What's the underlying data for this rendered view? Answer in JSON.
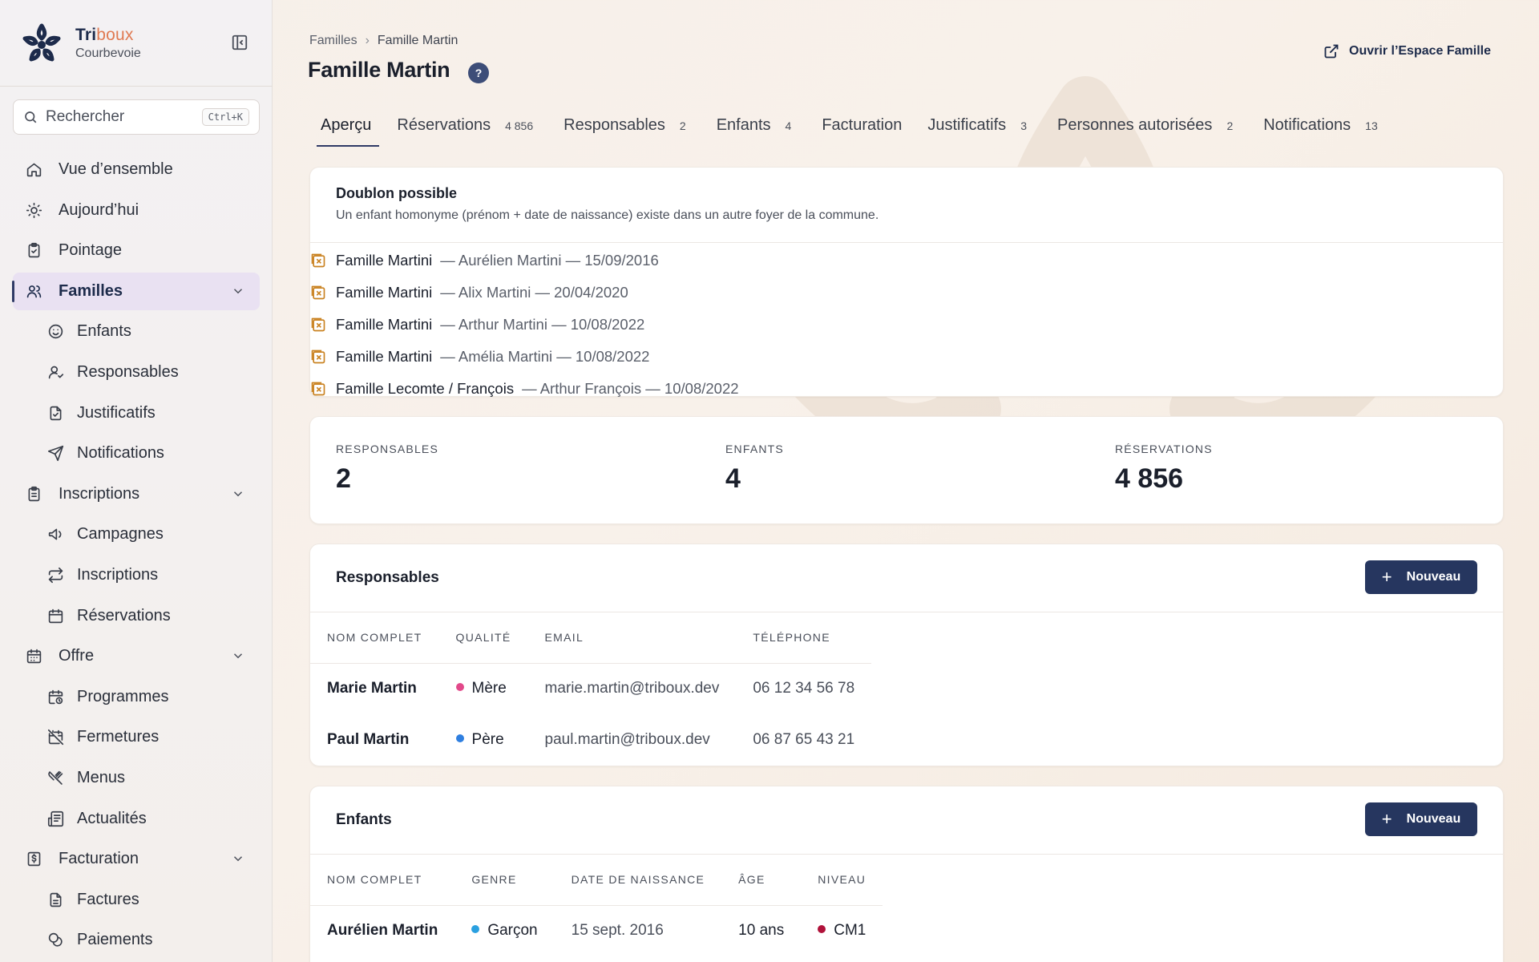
{
  "brand": {
    "name_part1": "Tri",
    "name_part2": "boux",
    "city": "Courbevoie"
  },
  "search": {
    "placeholder": "Rechercher",
    "shortcut": "Ctrl+K"
  },
  "sidebar": {
    "items": [
      {
        "label": "Vue d’ensemble",
        "icon": "home-icon"
      },
      {
        "label": "Aujourd’hui",
        "icon": "sun-icon"
      },
      {
        "label": "Pointage",
        "icon": "clipboard-check-icon"
      },
      {
        "label": "Familles",
        "icon": "users-icon",
        "active": true,
        "expanded": true
      },
      {
        "label": "Enfants",
        "icon": "smile-icon",
        "sub": true
      },
      {
        "label": "Responsables",
        "icon": "user-check-icon",
        "sub": true
      },
      {
        "label": "Justificatifs",
        "icon": "file-check-icon",
        "sub": true
      },
      {
        "label": "Notifications",
        "icon": "send-icon",
        "sub": true
      },
      {
        "label": "Inscriptions",
        "icon": "clipboard-list-icon",
        "expandable": true
      },
      {
        "label": "Campagnes",
        "icon": "megaphone-icon",
        "sub": true
      },
      {
        "label": "Inscriptions",
        "icon": "repeat-icon",
        "sub": true
      },
      {
        "label": "Réservations",
        "icon": "calendar-icon",
        "sub": true
      },
      {
        "label": "Offre",
        "icon": "calendar-days-icon",
        "expandable": true
      },
      {
        "label": "Programmes",
        "icon": "calendar-clock-icon",
        "sub": true
      },
      {
        "label": "Fermetures",
        "icon": "calendar-off-icon",
        "sub": true
      },
      {
        "label": "Menus",
        "icon": "utensils-icon",
        "sub": true
      },
      {
        "label": "Actualités",
        "icon": "newspaper-icon",
        "sub": true
      },
      {
        "label": "Facturation",
        "icon": "receipt-icon",
        "expandable": true
      },
      {
        "label": "Factures",
        "icon": "file-text-icon",
        "sub": true
      },
      {
        "label": "Paiements",
        "icon": "coins-icon",
        "sub": true
      }
    ]
  },
  "breadcrumb": {
    "parent": "Familles",
    "current": "Famille Martin"
  },
  "page": {
    "title": "Famille Martin",
    "help": "?",
    "open_space_label": "Ouvrir l’Espace Famille"
  },
  "tabs": [
    {
      "label": "Aperçu",
      "count": "",
      "active": true
    },
    {
      "label": "Réservations",
      "count": "4 856"
    },
    {
      "label": "Responsables",
      "count": "2"
    },
    {
      "label": "Enfants",
      "count": "4"
    },
    {
      "label": "Facturation",
      "count": ""
    },
    {
      "label": "Justificatifs",
      "count": "3"
    },
    {
      "label": "Personnes autorisées",
      "count": "2"
    },
    {
      "label": "Notifications",
      "count": "13"
    }
  ],
  "duplicate": {
    "title": "Doublon possible",
    "description": "Un enfant homonyme (prénom + date de naissance) existe dans un autre foyer de la commune.",
    "rows": [
      {
        "family": "Famille Martini",
        "detail": "— Aurélien Martini — 15/09/2016"
      },
      {
        "family": "Famille Martini",
        "detail": "— Alix Martini — 20/04/2020"
      },
      {
        "family": "Famille Martini",
        "detail": "— Arthur Martini — 10/08/2022"
      },
      {
        "family": "Famille Martini",
        "detail": "— Amélia Martini — 10/08/2022"
      },
      {
        "family": "Famille Lecomte / François",
        "detail": "— Arthur François — 10/08/2022"
      }
    ]
  },
  "stats": [
    {
      "label": "RESPONSABLES",
      "value": "2"
    },
    {
      "label": "ENFANTS",
      "value": "4"
    },
    {
      "label": "RÉSERVATIONS",
      "value": "4 856"
    }
  ],
  "responsables": {
    "title": "Responsables",
    "new_label": "Nouveau",
    "columns": [
      "NOM COMPLET",
      "QUALITÉ",
      "EMAIL",
      "TÉLÉPHONE"
    ],
    "rows": [
      {
        "name": "Marie Martin",
        "quality": "Mère",
        "quality_color": "#e2498a",
        "email": "marie.martin@triboux.dev",
        "phone": "06 12 34 56 78"
      },
      {
        "name": "Paul Martin",
        "quality": "Père",
        "quality_color": "#2f7fe0",
        "email": "paul.martin@triboux.dev",
        "phone": "06 87 65 43 21"
      }
    ]
  },
  "enfants": {
    "title": "Enfants",
    "new_label": "Nouveau",
    "columns": [
      "NOM COMPLET",
      "GENRE",
      "DATE DE NAISSANCE",
      "ÂGE",
      "NIVEAU"
    ],
    "rows": [
      {
        "name": "Aurélien Martin",
        "gender": "Garçon",
        "gender_color": "#2aa0e0",
        "birth": "15 sept. 2016",
        "age": "10 ans",
        "level": "CM1",
        "level_color": "#b0123a"
      }
    ]
  },
  "colors": {
    "accent": "#26365f",
    "brand_orange": "#e07a52",
    "active_nav_bg": "#e9e1f2",
    "duplicate_icon": "#c9811f"
  }
}
